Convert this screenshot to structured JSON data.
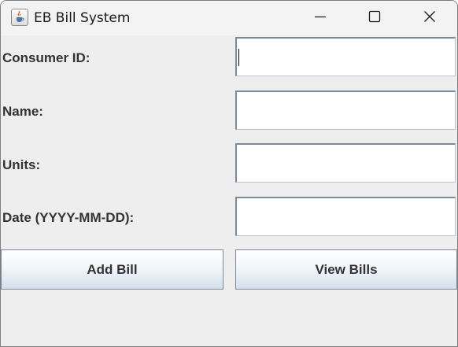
{
  "window": {
    "title": "EB Bill System",
    "app_icon": "java-cup-icon"
  },
  "titlebar_controls": {
    "minimize_icon": "minimize-icon",
    "maximize_icon": "maximize-icon",
    "close_icon": "close-icon"
  },
  "form": {
    "fields": [
      {
        "label": "Consumer ID:",
        "value": ""
      },
      {
        "label": "Name:",
        "value": ""
      },
      {
        "label": "Units:",
        "value": ""
      },
      {
        "label": "Date (YYYY-MM-DD):",
        "value": ""
      }
    ]
  },
  "buttons": {
    "add_label": "Add Bill",
    "view_label": "View Bills"
  },
  "colors": {
    "window_bg": "#eeeeee",
    "titlebar_bg": "#f3f3f3",
    "label_text": "#333333",
    "button_gradient_bottom": "#d4e0ec"
  }
}
